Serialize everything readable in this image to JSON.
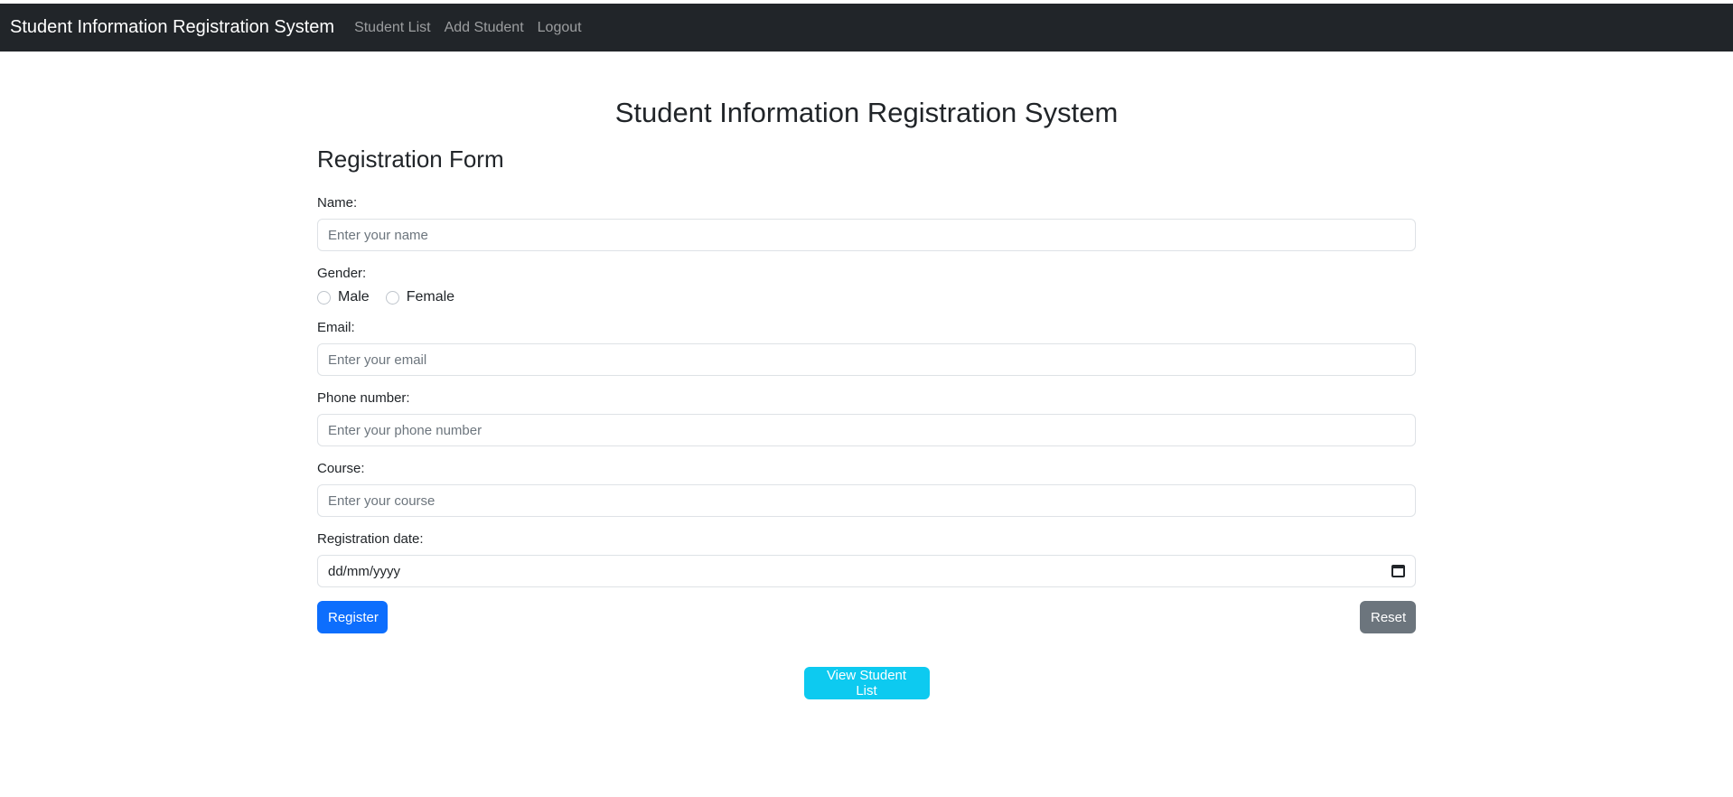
{
  "navbar": {
    "brand": "Student Information Registration System",
    "links": [
      {
        "label": "Student List"
      },
      {
        "label": "Add Student"
      },
      {
        "label": "Logout"
      }
    ]
  },
  "page": {
    "title": "Student Information Registration System",
    "form_title": "Registration Form"
  },
  "form": {
    "name": {
      "label": "Name:",
      "placeholder": "Enter your name",
      "value": ""
    },
    "gender": {
      "label": "Gender:",
      "options": [
        "Male",
        "Female"
      ],
      "selected": null
    },
    "email": {
      "label": "Email:",
      "placeholder": "Enter your email",
      "value": ""
    },
    "phone": {
      "label": "Phone number:",
      "placeholder": "Enter your phone number",
      "value": ""
    },
    "course": {
      "label": "Course:",
      "placeholder": "Enter your course",
      "value": ""
    },
    "registration_date": {
      "label": "Registration date:",
      "display": "dd/mm/yyyy",
      "icon": "calendar-icon"
    },
    "register_label": "Register",
    "reset_label": "Reset"
  },
  "actions": {
    "view_list_label": "View Student List"
  },
  "colors": {
    "navbar_bg": "#212529",
    "primary": "#0d6efd",
    "secondary": "#6c757d",
    "info": "#0dcaf0"
  }
}
